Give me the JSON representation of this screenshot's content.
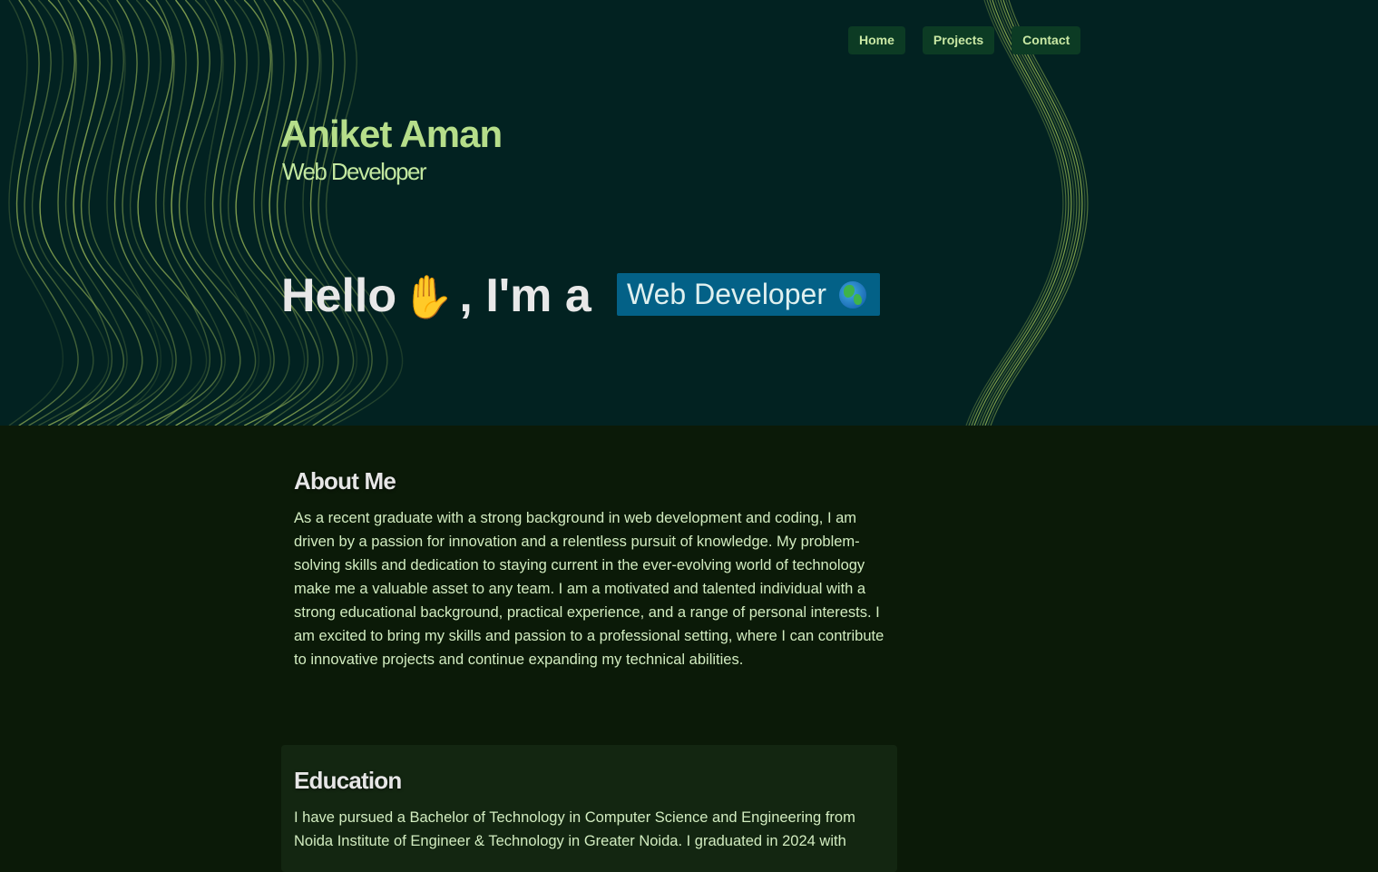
{
  "nav": {
    "items": [
      {
        "label": "Home"
      },
      {
        "label": "Projects"
      },
      {
        "label": "Contact"
      }
    ]
  },
  "hero": {
    "name": "Aniket Aman",
    "role": "Web Developer",
    "greeting_prefix": "Hello",
    "greeting_suffix": ", I'm a",
    "typed_text": "Web Developer",
    "wave_icon": "raised-hand-icon",
    "globe_icon": "globe-icon"
  },
  "about": {
    "title": "About Me",
    "text": "As a recent graduate with a strong background in web development and coding, I am driven by a passion for innovation and a relentless pursuit of knowledge. My problem-solving skills and dedication to staying current in the ever-evolving world of technology make me a valuable asset to any team. I am a motivated and talented individual with a strong educational background, practical experience, and a range of personal interests. I am excited to bring my skills and passion to a professional setting, where I can contribute to innovative projects and continue expanding my technical abilities."
  },
  "education": {
    "title": "Education",
    "text": "I have pursued a Bachelor of Technology in Computer Science and Engineering from Noida Institute of Engineer & Technology in Greater Noida. I graduated in 2024 with"
  },
  "colors": {
    "hero_bg": "#022221",
    "page_bg": "#0b1a08",
    "accent_green": "#b6de8a",
    "nav_button_bg": "#0c3b24",
    "typed_box_bg": "#036187"
  }
}
